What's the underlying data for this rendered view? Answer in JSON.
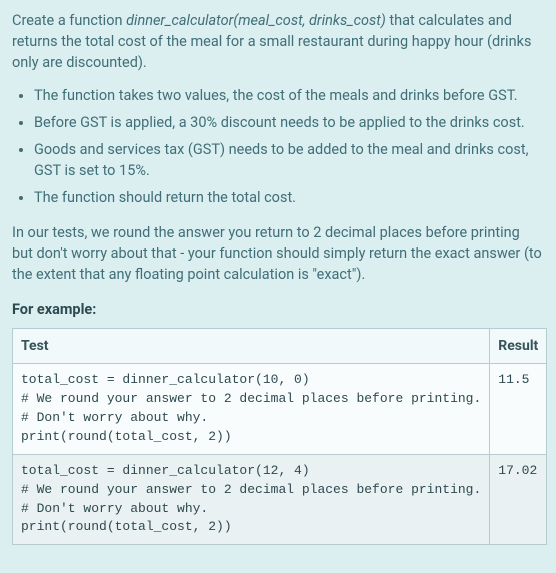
{
  "intro": {
    "prefix": "Create a function ",
    "signature": "dinner_calculator(meal_cost, drinks_cost)",
    "suffix": " that calculates and returns the total cost of the meal for a small restaurant during happy hour (drinks only are discounted)."
  },
  "bullets": [
    "The function takes two values, the cost of the meals and drinks before GST.",
    "Before GST is applied, a 30% discount needs to be applied to the drinks cost.",
    "Goods and services tax (GST) needs to be added to the meal and drinks cost, GST is set to 15%.",
    "The function should return the total cost."
  ],
  "note": "In our tests, we round the answer you return to 2 decimal places before printing but don't worry about that - your function should simply return the exact answer (to the extent that any floating point calculation is \"exact\").",
  "example_label": "For example:",
  "table": {
    "headers": {
      "test": "Test",
      "result": "Result"
    },
    "rows": [
      {
        "test": "total_cost = dinner_calculator(10, 0)\n# We round your answer to 2 decimal places before printing.\n# Don't worry about why.\nprint(round(total_cost, 2))",
        "result": "11.5"
      },
      {
        "test": "total_cost = dinner_calculator(12, 4)\n# We round your answer to 2 decimal places before printing.\n# Don't worry about why.\nprint(round(total_cost, 2))",
        "result": "17.02"
      }
    ]
  }
}
